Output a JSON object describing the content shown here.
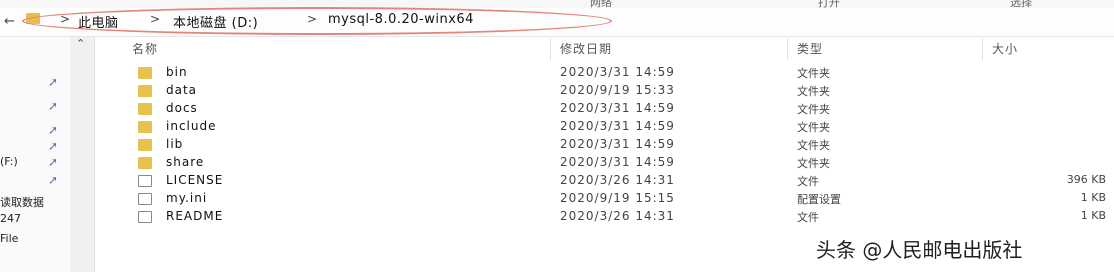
{
  "ribbon": {
    "items": [
      "网络",
      "打开",
      "选择"
    ]
  },
  "address_bar": {
    "breadcrumbs": [
      {
        "label": "此电脑"
      },
      {
        "label": "本地磁盘 (D:)"
      },
      {
        "label": "mysql-8.0.20-winx64"
      }
    ]
  },
  "nav_pane": {
    "items": [
      {
        "label": ""
      },
      {
        "label": ""
      },
      {
        "label": ""
      },
      {
        "label": ""
      },
      {
        "label": "(F:)"
      },
      {
        "label": "读取数据"
      },
      {
        "label": "247"
      },
      {
        "label": "File"
      }
    ]
  },
  "columns": {
    "name": "名称",
    "date": "修改日期",
    "type": "类型",
    "size": "大小"
  },
  "files": [
    {
      "name": "bin",
      "date": "2020/3/31 14:59",
      "type": "文件夹",
      "size": "",
      "icon": "folder-icon"
    },
    {
      "name": "data",
      "date": "2020/9/19 15:33",
      "type": "文件夹",
      "size": "",
      "icon": "folder-icon"
    },
    {
      "name": "docs",
      "date": "2020/3/31 14:59",
      "type": "文件夹",
      "size": "",
      "icon": "folder-icon"
    },
    {
      "name": "include",
      "date": "2020/3/31 14:59",
      "type": "文件夹",
      "size": "",
      "icon": "folder-icon"
    },
    {
      "name": "lib",
      "date": "2020/3/31 14:59",
      "type": "文件夹",
      "size": "",
      "icon": "folder-icon"
    },
    {
      "name": "share",
      "date": "2020/3/31 14:59",
      "type": "文件夹",
      "size": "",
      "icon": "folder-icon"
    },
    {
      "name": "LICENSE",
      "date": "2020/3/26 14:31",
      "type": "文件",
      "size": "396 KB",
      "icon": "file-icon"
    },
    {
      "name": "my.ini",
      "date": "2020/9/19 15:15",
      "type": "配置设置",
      "size": "1 KB",
      "icon": "settings-file-icon"
    },
    {
      "name": "README",
      "date": "2020/3/26 14:31",
      "type": "文件",
      "size": "1 KB",
      "icon": "file-icon"
    }
  ],
  "watermark": "头条 @人民邮电出版社"
}
